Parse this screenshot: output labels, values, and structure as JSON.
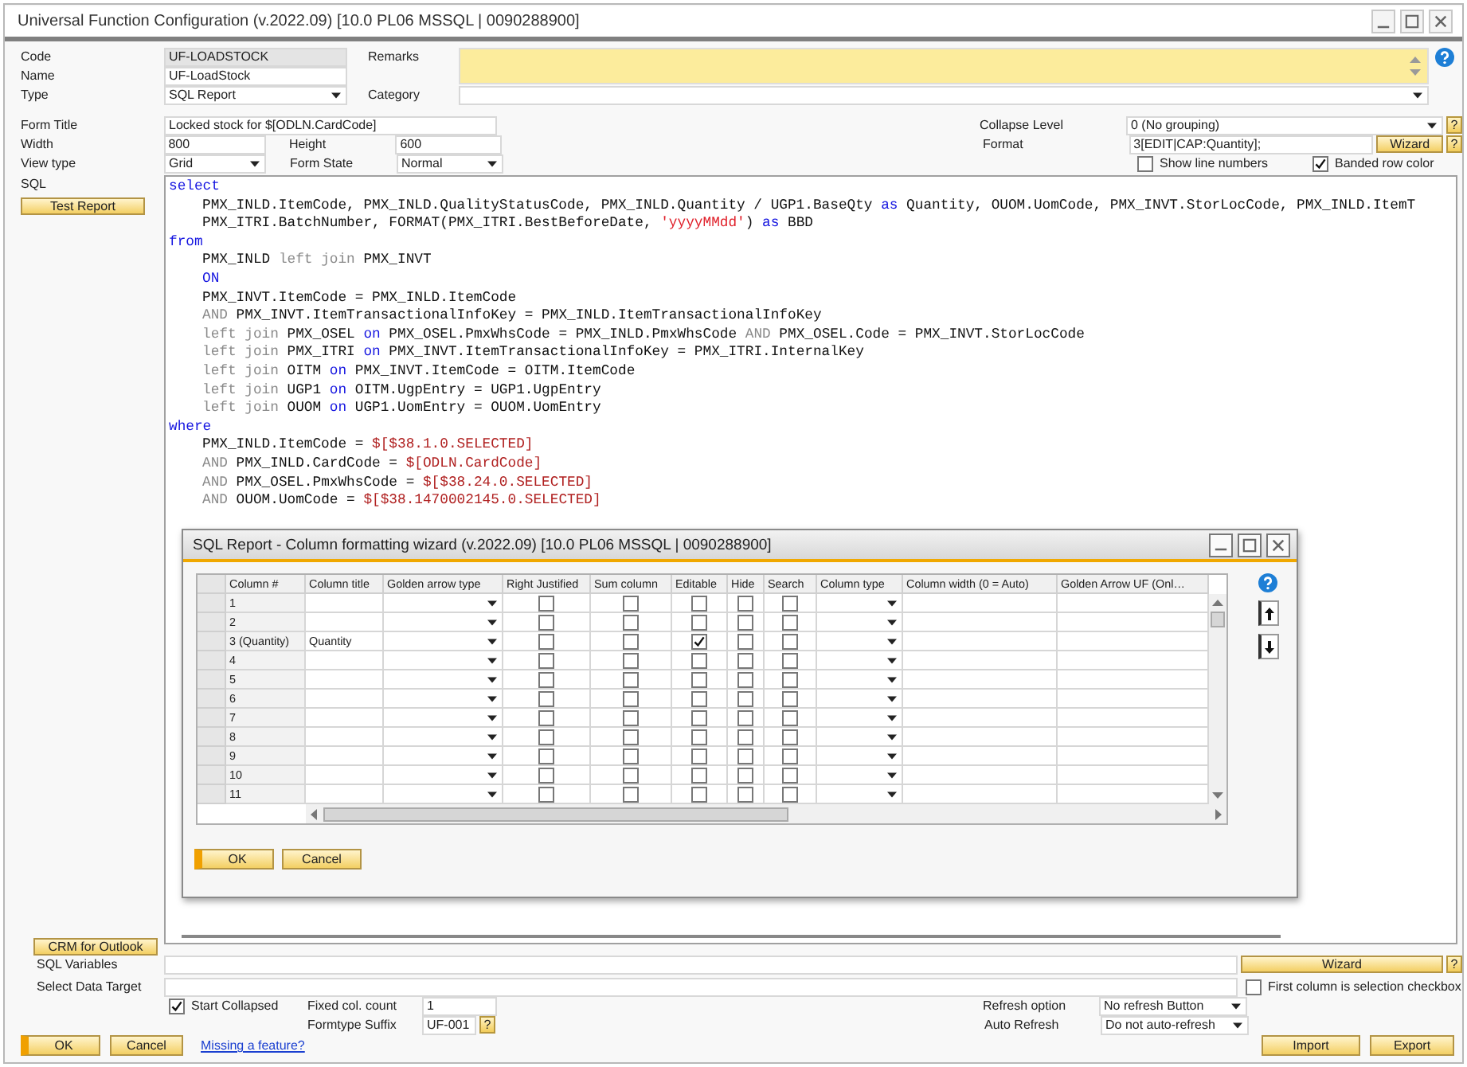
{
  "window": {
    "title": "Universal Function Configuration (v.2022.09) [10.0 PL06 MSSQL | 0090288900]"
  },
  "header": {
    "code": {
      "label": "Code",
      "value": "UF-LOADSTOCK"
    },
    "name": {
      "label": "Name",
      "value": "UF-LoadStock"
    },
    "type": {
      "label": "Type",
      "value": "SQL Report"
    },
    "remarks": {
      "label": "Remarks"
    },
    "category": {
      "label": "Category"
    }
  },
  "form": {
    "form_title": {
      "label": "Form Title",
      "value": "Locked stock for $[ODLN.CardCode]"
    },
    "width": {
      "label": "Width",
      "value": "800"
    },
    "height": {
      "label": "Height",
      "value": "600"
    },
    "view_type": {
      "label": "View type",
      "value": "Grid"
    },
    "form_state": {
      "label": "Form State",
      "value": "Normal"
    },
    "collapse_level": {
      "label": "Collapse Level",
      "value": "0 (No grouping)",
      "help": "?"
    },
    "format": {
      "label": "Format",
      "value": "3[EDIT|CAP:Quantity];",
      "button": "Wizard",
      "help": "?"
    },
    "show_line_numbers": {
      "label": "Show line numbers",
      "checked": false
    },
    "banded_row_color": {
      "label": "Banded row color",
      "checked": true
    }
  },
  "sql": {
    "label": "SQL",
    "test_button": "Test Report",
    "crm_button": "CRM for Outlook",
    "clauses": [
      {
        "keyword": "select",
        "lines": [
          [
            {
              "text": "PMX_INLD.ItemCode, PMX_INLD.QualityStatusCode, PMX_INLD.Quantity / UGP1.BaseQty ",
              "kind": "plain"
            },
            {
              "text": "as",
              "kind": "keyword"
            },
            {
              "text": " Quantity, OUOM.UomCode, PMX_INVT.StorLocCode, PMX_INLD.ItemT",
              "kind": "plain"
            }
          ],
          [
            {
              "text": "PMX_ITRI.BatchNumber, FORMAT(PMX_ITRI.BestBeforeDate, ",
              "kind": "plain"
            },
            {
              "text": "'yyyyMMdd'",
              "kind": "string"
            },
            {
              "text": ") ",
              "kind": "plain"
            },
            {
              "text": "as",
              "kind": "keyword"
            },
            {
              "text": " BBD",
              "kind": "plain"
            }
          ]
        ]
      },
      {
        "keyword": "from",
        "lines": [
          [
            {
              "text": "PMX_INLD ",
              "kind": "plain"
            },
            {
              "text": "left join",
              "kind": "join"
            },
            {
              "text": " PMX_INVT",
              "kind": "plain"
            }
          ],
          [
            {
              "text": "ON",
              "kind": "keyword"
            }
          ],
          [
            {
              "text": "PMX_INVT.ItemCode = PMX_INLD.ItemCode",
              "kind": "plain"
            }
          ],
          [
            {
              "text": "AND",
              "kind": "join"
            },
            {
              "text": " PMX_INVT.ItemTransactionalInfoKey = PMX_INLD.ItemTransactionalInfoKey",
              "kind": "plain"
            }
          ],
          [
            {
              "text": "left join",
              "kind": "join"
            },
            {
              "text": " PMX_OSEL ",
              "kind": "plain"
            },
            {
              "text": "on",
              "kind": "keyword"
            },
            {
              "text": " PMX_OSEL.PmxWhsCode = PMX_INLD.PmxWhsCode ",
              "kind": "plain"
            },
            {
              "text": "AND",
              "kind": "join"
            },
            {
              "text": " PMX_OSEL.Code = PMX_INVT.StorLocCode",
              "kind": "plain"
            }
          ],
          [
            {
              "text": "left join",
              "kind": "join"
            },
            {
              "text": " PMX_ITRI ",
              "kind": "plain"
            },
            {
              "text": "on",
              "kind": "keyword"
            },
            {
              "text": " PMX_INVT.ItemTransactionalInfoKey = PMX_ITRI.InternalKey",
              "kind": "plain"
            }
          ],
          [
            {
              "text": "left join",
              "kind": "join"
            },
            {
              "text": " OITM ",
              "kind": "plain"
            },
            {
              "text": "on",
              "kind": "keyword"
            },
            {
              "text": " PMX_INVT.ItemCode = OITM.ItemCode",
              "kind": "plain"
            }
          ],
          [
            {
              "text": "left join",
              "kind": "join"
            },
            {
              "text": " UGP1 ",
              "kind": "plain"
            },
            {
              "text": "on",
              "kind": "keyword"
            },
            {
              "text": " OITM.UgpEntry = UGP1.UgpEntry",
              "kind": "plain"
            }
          ],
          [
            {
              "text": "left join",
              "kind": "join"
            },
            {
              "text": " OUOM ",
              "kind": "plain"
            },
            {
              "text": "on",
              "kind": "keyword"
            },
            {
              "text": " UGP1.UomEntry = OUOM.UomEntry",
              "kind": "plain"
            }
          ]
        ]
      },
      {
        "keyword": "where",
        "lines": [
          [
            {
              "text": "PMX_INLD.ItemCode = ",
              "kind": "plain"
            },
            {
              "text": "$[$38.1.0.SELECTED]",
              "kind": "param"
            }
          ],
          [
            {
              "text": "AND",
              "kind": "join"
            },
            {
              "text": " PMX_INLD.CardCode = ",
              "kind": "plain"
            },
            {
              "text": "$[ODLN.CardCode]",
              "kind": "param"
            }
          ],
          [
            {
              "text": "AND",
              "kind": "join"
            },
            {
              "text": " PMX_OSEL.PmxWhsCode = ",
              "kind": "plain"
            },
            {
              "text": "$[$38.24.0.SELECTED]",
              "kind": "param"
            }
          ],
          [
            {
              "text": "AND",
              "kind": "join"
            },
            {
              "text": " OUOM.UomCode = ",
              "kind": "plain"
            },
            {
              "text": "$[$38.1470002145.0.SELECTED]",
              "kind": "param"
            }
          ]
        ]
      }
    ]
  },
  "dialog": {
    "title": "SQL Report - Column formatting wizard (v.2022.09) [10.0 PL06 MSSQL | 0090288900]",
    "columns": [
      {
        "label": "Column #",
        "kind": "number"
      },
      {
        "label": "Column title",
        "kind": "title"
      },
      {
        "label": "Golden arrow type",
        "kind": "dropdown"
      },
      {
        "label": "Right Justified",
        "kind": "checkbox"
      },
      {
        "label": "Sum column",
        "kind": "checkbox"
      },
      {
        "label": "Editable",
        "kind": "checkbox"
      },
      {
        "label": "Hide",
        "kind": "checkbox"
      },
      {
        "label": "Search",
        "kind": "checkbox"
      },
      {
        "label": "Column type",
        "kind": "dropdown"
      },
      {
        "label": "Column width (0 = Auto)",
        "kind": "input"
      },
      {
        "label": "Golden Arrow UF (Onl…",
        "kind": "input"
      }
    ],
    "rows": [
      {
        "number": "1",
        "checks": [
          false,
          false,
          false,
          false,
          false
        ]
      },
      {
        "number": "2",
        "checks": [
          false,
          false,
          false,
          false,
          false
        ]
      },
      {
        "number": "3 (Quantity)",
        "title": "Quantity",
        "checks": [
          false,
          false,
          true,
          false,
          false
        ]
      },
      {
        "number": "4",
        "checks": [
          false,
          false,
          false,
          false,
          false
        ]
      },
      {
        "number": "5",
        "checks": [
          false,
          false,
          false,
          false,
          false
        ]
      },
      {
        "number": "6",
        "checks": [
          false,
          false,
          false,
          false,
          false
        ]
      },
      {
        "number": "7",
        "checks": [
          false,
          false,
          false,
          false,
          false
        ]
      },
      {
        "number": "8",
        "checks": [
          false,
          false,
          false,
          false,
          false
        ]
      },
      {
        "number": "9",
        "checks": [
          false,
          false,
          false,
          false,
          false
        ]
      },
      {
        "number": "10",
        "checks": [
          false,
          false,
          false,
          false,
          false
        ]
      },
      {
        "number": "11",
        "checks": [
          false,
          false,
          false,
          false,
          false
        ]
      }
    ],
    "ok_button": "OK",
    "cancel_button": "Cancel"
  },
  "footer": {
    "sql_variables": {
      "label": "SQL Variables",
      "button": "Wizard",
      "help": "?"
    },
    "select_data_target": {
      "label": "Select Data Target"
    },
    "first_column_checkbox": {
      "label": "First column is selection checkbox",
      "checked": false
    },
    "start_collapsed": {
      "label": "Start Collapsed",
      "checked": true
    },
    "fixed_col_count": {
      "label": "Fixed col. count",
      "value": "1"
    },
    "formtype_suffix": {
      "label": "Formtype Suffix",
      "value": "UF-001",
      "help": "?"
    },
    "refresh_option": {
      "label": "Refresh option",
      "value": "No refresh Button"
    },
    "auto_refresh": {
      "label": "Auto Refresh",
      "value": "Do not auto-refresh"
    },
    "ok_button": "OK",
    "cancel_button": "Cancel",
    "missing_link": "Missing a feature?",
    "import_button": "Import",
    "export_button": "Export"
  }
}
